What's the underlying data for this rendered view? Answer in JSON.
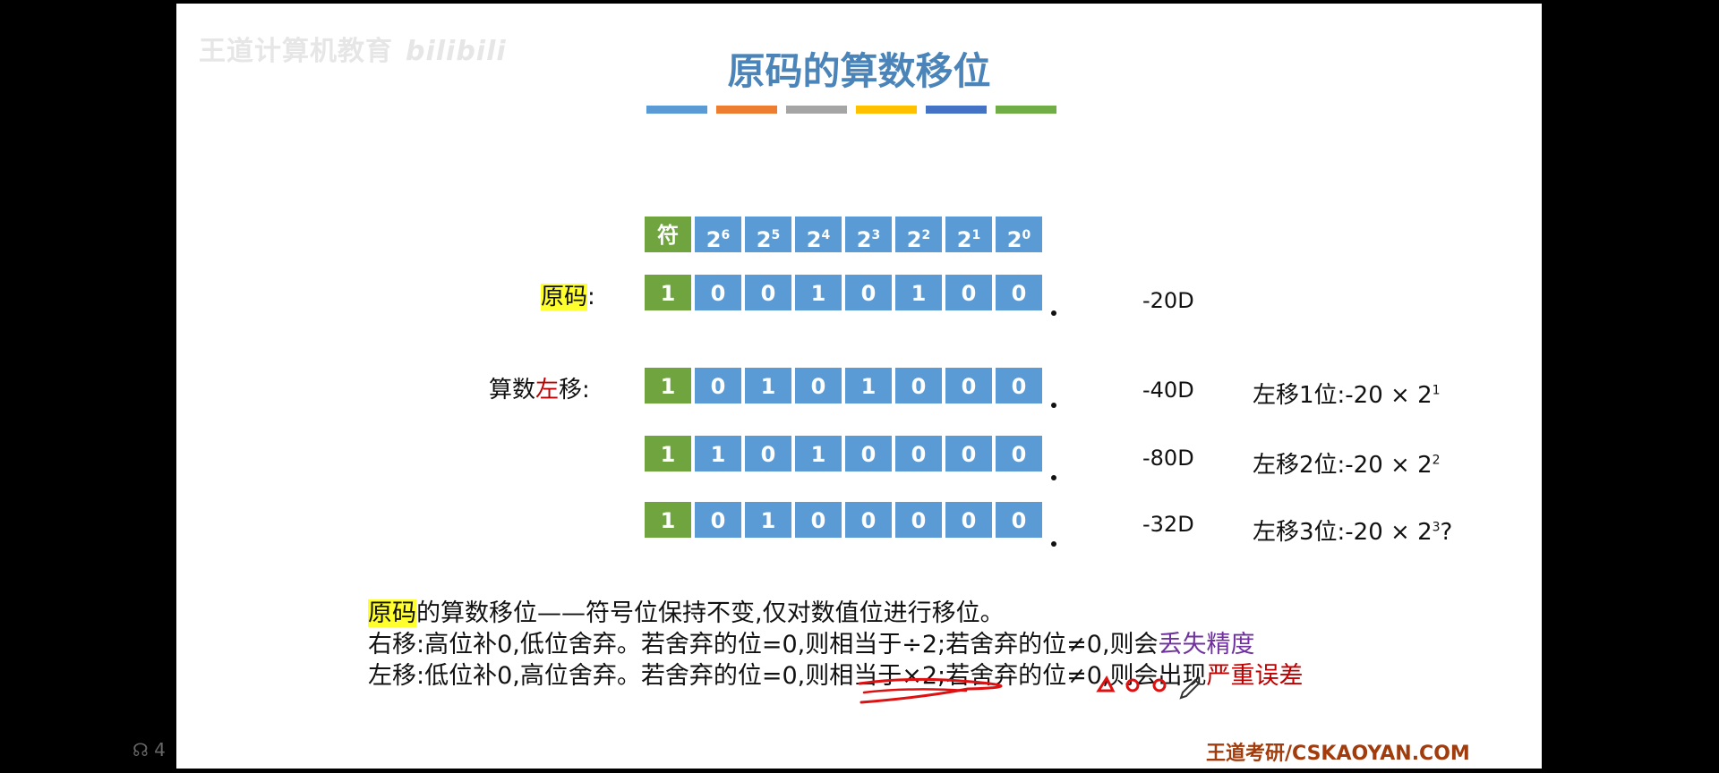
{
  "watermark": {
    "text": "王道计算机教育",
    "logo": "bilibili"
  },
  "title": "原码的算数移位",
  "accent_colors": [
    "#5b9bd5",
    "#ed7d31",
    "#a5a5a5",
    "#ffc000",
    "#4472c4",
    "#70ad47"
  ],
  "header_row": {
    "sign": "符",
    "bits": [
      {
        "base": "2",
        "exp": "6"
      },
      {
        "base": "2",
        "exp": "5"
      },
      {
        "base": "2",
        "exp": "4"
      },
      {
        "base": "2",
        "exp": "3"
      },
      {
        "base": "2",
        "exp": "2"
      },
      {
        "base": "2",
        "exp": "1"
      },
      {
        "base": "2",
        "exp": "0"
      }
    ]
  },
  "rows": [
    {
      "label": "原码",
      "label_suffix": ":",
      "bits": [
        "1",
        "0",
        "0",
        "1",
        "0",
        "1",
        "0",
        "0"
      ],
      "decimal": "-20D"
    },
    {
      "label_pre": "算数",
      "label_mid": "左",
      "label_post": "移:",
      "bits": [
        "1",
        "0",
        "1",
        "0",
        "1",
        "0",
        "0",
        "0"
      ],
      "decimal": "-40D",
      "note_text": "左移1位:-20 × 2",
      "note_exp": "1"
    },
    {
      "bits": [
        "1",
        "1",
        "0",
        "1",
        "0",
        "0",
        "0",
        "0"
      ],
      "decimal": "-80D",
      "note_text": "左移2位:-20 × 2",
      "note_exp": "2"
    },
    {
      "bits": [
        "1",
        "0",
        "1",
        "0",
        "0",
        "0",
        "0",
        "0"
      ],
      "decimal": "-32D",
      "note_text": "左移3位:-20 × 2",
      "note_exp": "3",
      "note_suffix": "?"
    }
  ],
  "rules": {
    "line1_hl": "原码",
    "line1_rest": "的算数移位——符号位保持不变,仅对数值位进行移位。",
    "line2_main": "右移:高位补0,低位舍弃。若舍弃的位=0,则相当于÷2;若舍弃的位≠0,则会",
    "line2_emph": "丢失精度",
    "line3_main": "左移:低位补0,高位舍弃。若舍弃的位=0,则相当于×2;若舍弃的位≠0,则会出现",
    "line3_emph": "严重误差"
  },
  "footer": "王道考研/CSKAOYAN.COM",
  "side_count": "4"
}
